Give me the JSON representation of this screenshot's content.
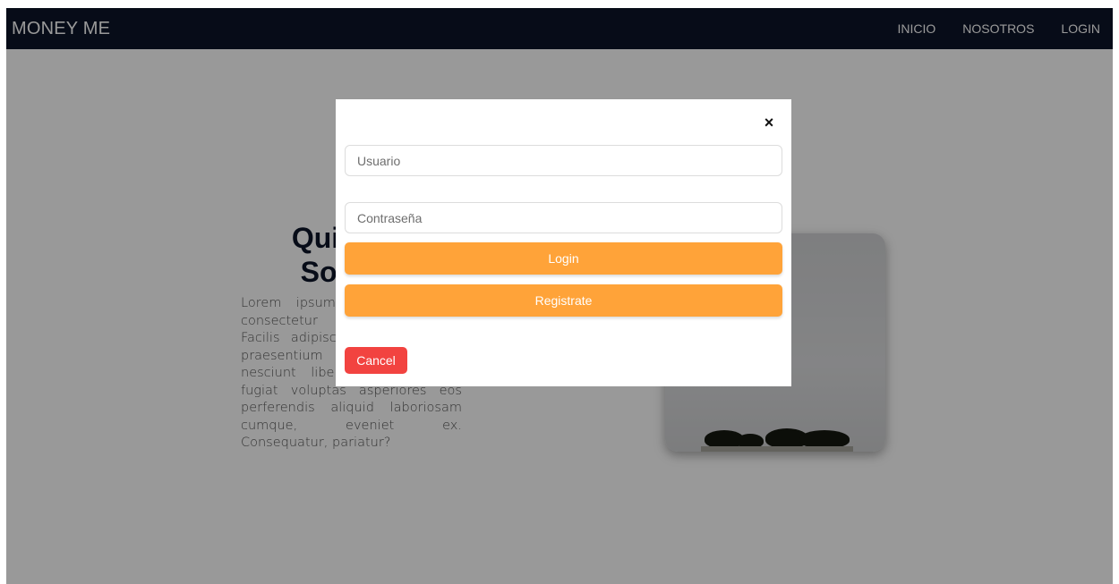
{
  "navbar": {
    "brand": "MONEY ME",
    "links": [
      "INICIO",
      "NOSOTROS",
      "LOGIN"
    ]
  },
  "hero": {
    "title_line1": "Quienes",
    "title_line2": "Somos",
    "text": "Lorem ipsum dolor sit amet consectetur adipisicing elit. Facilis adipisci ipsa esse optio praesentium voluptatem magni nesciunt libero, veritatis odio fugiat voluptas asperiores eos perferendis aliquid laboriosam cumque, eveniet ex. Consequatur, pariatur?"
  },
  "modal": {
    "close_symbol": "×",
    "user_placeholder": "Usuario",
    "password_placeholder": "Contraseña",
    "login_label": "Login",
    "register_label": "Registrate",
    "cancel_label": "Cancel"
  },
  "colors": {
    "navbar_bg": "#0d1528",
    "primary_button": "#ffa339",
    "cancel_button": "#f24340",
    "overlay": "rgba(0,0,0,0.4)"
  },
  "icons": {
    "close": "close-icon"
  }
}
